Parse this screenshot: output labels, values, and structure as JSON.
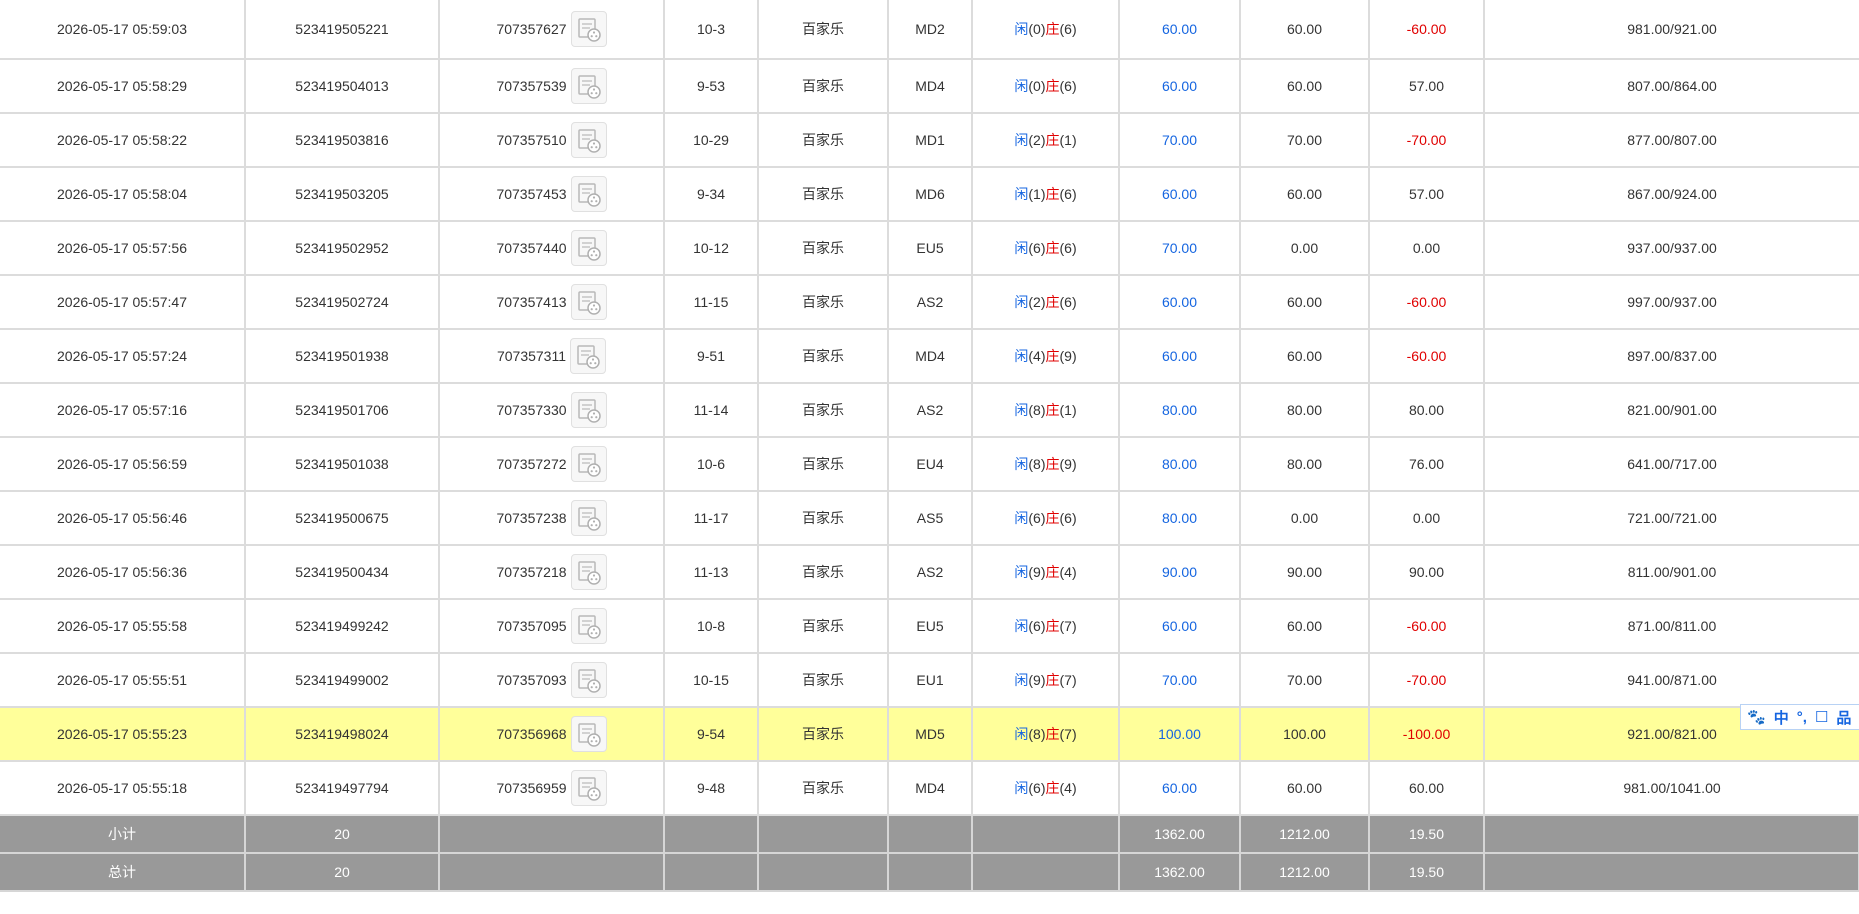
{
  "rows": [
    {
      "time": "2026-05-17 05:59:03",
      "bet_id": "523419505221",
      "round_id": "707357627",
      "shoe": "10-3",
      "game": "百家乐",
      "table": "MD2",
      "player": "闲",
      "player_pts": "(0)",
      "banker": "庄",
      "banker_pts": "(6)",
      "bet": "60.00",
      "valid": "60.00",
      "winloss": "-60.00",
      "balance": "981.00/921.00"
    },
    {
      "time": "2026-05-17 05:58:29",
      "bet_id": "523419504013",
      "round_id": "707357539",
      "shoe": "9-53",
      "game": "百家乐",
      "table": "MD4",
      "player": "闲",
      "player_pts": "(0)",
      "banker": "庄",
      "banker_pts": "(6)",
      "bet": "60.00",
      "valid": "60.00",
      "winloss": "57.00",
      "balance": "807.00/864.00"
    },
    {
      "time": "2026-05-17 05:58:22",
      "bet_id": "523419503816",
      "round_id": "707357510",
      "shoe": "10-29",
      "game": "百家乐",
      "table": "MD1",
      "player": "闲",
      "player_pts": "(2)",
      "banker": "庄",
      "banker_pts": "(1)",
      "bet": "70.00",
      "valid": "70.00",
      "winloss": "-70.00",
      "balance": "877.00/807.00"
    },
    {
      "time": "2026-05-17 05:58:04",
      "bet_id": "523419503205",
      "round_id": "707357453",
      "shoe": "9-34",
      "game": "百家乐",
      "table": "MD6",
      "player": "闲",
      "player_pts": "(1)",
      "banker": "庄",
      "banker_pts": "(6)",
      "bet": "60.00",
      "valid": "60.00",
      "winloss": "57.00",
      "balance": "867.00/924.00"
    },
    {
      "time": "2026-05-17 05:57:56",
      "bet_id": "523419502952",
      "round_id": "707357440",
      "shoe": "10-12",
      "game": "百家乐",
      "table": "EU5",
      "player": "闲",
      "player_pts": "(6)",
      "banker": "庄",
      "banker_pts": "(6)",
      "bet": "70.00",
      "valid": "0.00",
      "winloss": "0.00",
      "balance": "937.00/937.00"
    },
    {
      "time": "2026-05-17 05:57:47",
      "bet_id": "523419502724",
      "round_id": "707357413",
      "shoe": "11-15",
      "game": "百家乐",
      "table": "AS2",
      "player": "闲",
      "player_pts": "(2)",
      "banker": "庄",
      "banker_pts": "(6)",
      "bet": "60.00",
      "valid": "60.00",
      "winloss": "-60.00",
      "balance": "997.00/937.00"
    },
    {
      "time": "2026-05-17 05:57:24",
      "bet_id": "523419501938",
      "round_id": "707357311",
      "shoe": "9-51",
      "game": "百家乐",
      "table": "MD4",
      "player": "闲",
      "player_pts": "(4)",
      "banker": "庄",
      "banker_pts": "(9)",
      "bet": "60.00",
      "valid": "60.00",
      "winloss": "-60.00",
      "balance": "897.00/837.00"
    },
    {
      "time": "2026-05-17 05:57:16",
      "bet_id": "523419501706",
      "round_id": "707357330",
      "shoe": "11-14",
      "game": "百家乐",
      "table": "AS2",
      "player": "闲",
      "player_pts": "(8)",
      "banker": "庄",
      "banker_pts": "(1)",
      "bet": "80.00",
      "valid": "80.00",
      "winloss": "80.00",
      "balance": "821.00/901.00"
    },
    {
      "time": "2026-05-17 05:56:59",
      "bet_id": "523419501038",
      "round_id": "707357272",
      "shoe": "10-6",
      "game": "百家乐",
      "table": "EU4",
      "player": "闲",
      "player_pts": "(8)",
      "banker": "庄",
      "banker_pts": "(9)",
      "bet": "80.00",
      "valid": "80.00",
      "winloss": "76.00",
      "balance": "641.00/717.00"
    },
    {
      "time": "2026-05-17 05:56:46",
      "bet_id": "523419500675",
      "round_id": "707357238",
      "shoe": "11-17",
      "game": "百家乐",
      "table": "AS5",
      "player": "闲",
      "player_pts": "(6)",
      "banker": "庄",
      "banker_pts": "(6)",
      "bet": "80.00",
      "valid": "0.00",
      "winloss": "0.00",
      "balance": "721.00/721.00"
    },
    {
      "time": "2026-05-17 05:56:36",
      "bet_id": "523419500434",
      "round_id": "707357218",
      "shoe": "11-13",
      "game": "百家乐",
      "table": "AS2",
      "player": "闲",
      "player_pts": "(9)",
      "banker": "庄",
      "banker_pts": "(4)",
      "bet": "90.00",
      "valid": "90.00",
      "winloss": "90.00",
      "balance": "811.00/901.00"
    },
    {
      "time": "2026-05-17 05:55:58",
      "bet_id": "523419499242",
      "round_id": "707357095",
      "shoe": "10-8",
      "game": "百家乐",
      "table": "EU5",
      "player": "闲",
      "player_pts": "(6)",
      "banker": "庄",
      "banker_pts": "(7)",
      "bet": "60.00",
      "valid": "60.00",
      "winloss": "-60.00",
      "balance": "871.00/811.00"
    },
    {
      "time": "2026-05-17 05:55:51",
      "bet_id": "523419499002",
      "round_id": "707357093",
      "shoe": "10-15",
      "game": "百家乐",
      "table": "EU1",
      "player": "闲",
      "player_pts": "(9)",
      "banker": "庄",
      "banker_pts": "(7)",
      "bet": "70.00",
      "valid": "70.00",
      "winloss": "-70.00",
      "balance": "941.00/871.00"
    },
    {
      "time": "2026-05-17 05:55:23",
      "bet_id": "523419498024",
      "round_id": "707356968",
      "shoe": "9-54",
      "game": "百家乐",
      "table": "MD5",
      "player": "闲",
      "player_pts": "(8)",
      "banker": "庄",
      "banker_pts": "(7)",
      "bet": "100.00",
      "valid": "100.00",
      "winloss": "-100.00",
      "balance": "921.00/821.00",
      "highlighted": true
    },
    {
      "time": "2026-05-17 05:55:18",
      "bet_id": "523419497794",
      "round_id": "707356959",
      "shoe": "9-48",
      "game": "百家乐",
      "table": "MD4",
      "player": "闲",
      "player_pts": "(6)",
      "banker": "庄",
      "banker_pts": "(4)",
      "bet": "60.00",
      "valid": "60.00",
      "winloss": "60.00",
      "balance": "981.00/1041.00"
    }
  ],
  "summary": [
    {
      "label": "小计",
      "count": "20",
      "bet": "1362.00",
      "valid": "1212.00",
      "winloss": "19.50"
    },
    {
      "label": "总计",
      "count": "20",
      "bet": "1362.00",
      "valid": "1212.00",
      "winloss": "19.50"
    }
  ],
  "ime_toolbar": {
    "paw": "🐾",
    "lang": "中",
    "punct": "°,",
    "item4": "☐",
    "item5": "品"
  },
  "colors": {
    "blue": "#1565e0",
    "red": "#e00000",
    "highlight": "#ffff9a",
    "summary_bg": "#999999"
  },
  "icons": {
    "replay": "video-replay-icon"
  }
}
